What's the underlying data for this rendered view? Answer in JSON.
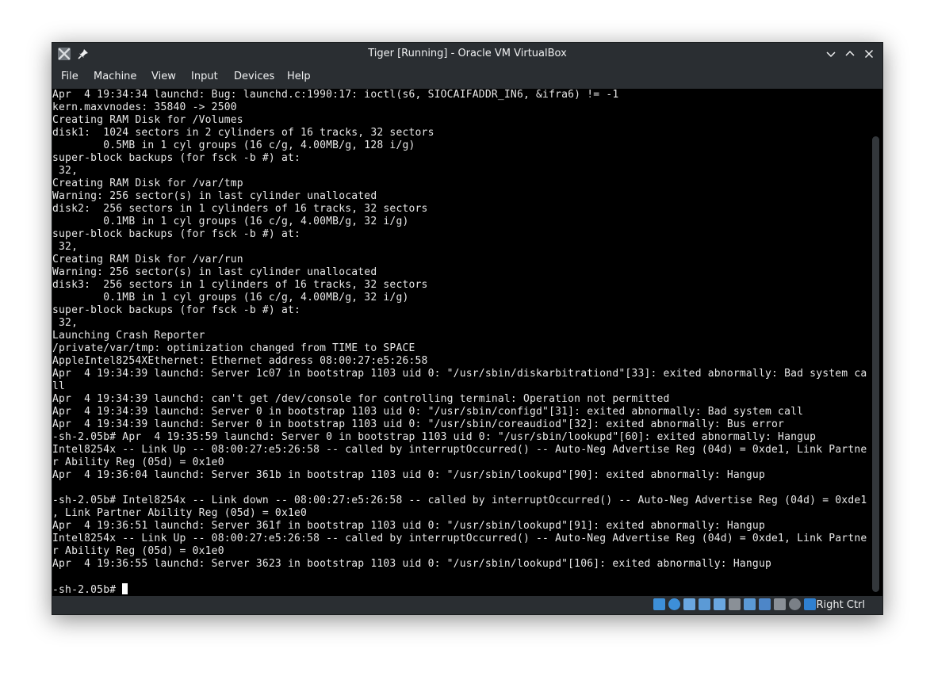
{
  "window": {
    "title": "Tiger [Running] - Oracle VM VirtualBox"
  },
  "menubar": {
    "items": [
      "File",
      "Machine",
      "View",
      "Input",
      "Devices",
      "Help"
    ]
  },
  "console": {
    "lines": [
      "Apr  4 19:34:34 launchd: Bug: launchd.c:1990:17: ioctl(s6, SIOCAIFADDR_IN6, &ifra6) != -1",
      "kern.maxvnodes: 35840 -> 2500",
      "Creating RAM Disk for /Volumes",
      "disk1:  1024 sectors in 2 cylinders of 16 tracks, 32 sectors",
      "        0.5MB in 1 cyl groups (16 c/g, 4.00MB/g, 128 i/g)",
      "super-block backups (for fsck -b #) at:",
      " 32,",
      "Creating RAM Disk for /var/tmp",
      "Warning: 256 sector(s) in last cylinder unallocated",
      "disk2:  256 sectors in 1 cylinders of 16 tracks, 32 sectors",
      "        0.1MB in 1 cyl groups (16 c/g, 4.00MB/g, 32 i/g)",
      "super-block backups (for fsck -b #) at:",
      " 32,",
      "Creating RAM Disk for /var/run",
      "Warning: 256 sector(s) in last cylinder unallocated",
      "disk3:  256 sectors in 1 cylinders of 16 tracks, 32 sectors",
      "        0.1MB in 1 cyl groups (16 c/g, 4.00MB/g, 32 i/g)",
      "super-block backups (for fsck -b #) at:",
      " 32,",
      "Launching Crash Reporter",
      "/private/var/tmp: optimization changed from TIME to SPACE",
      "AppleIntel8254XEthernet: Ethernet address 08:00:27:e5:26:58",
      "Apr  4 19:34:39 launchd: Server 1c07 in bootstrap 1103 uid 0: \"/usr/sbin/diskarbitrationd\"[33]: exited abnormally: Bad system ca",
      "ll",
      "Apr  4 19:34:39 launchd: can't get /dev/console for controlling terminal: Operation not permitted",
      "Apr  4 19:34:39 launchd: Server 0 in bootstrap 1103 uid 0: \"/usr/sbin/configd\"[31]: exited abnormally: Bad system call",
      "Apr  4 19:34:39 launchd: Server 0 in bootstrap 1103 uid 0: \"/usr/sbin/coreaudiod\"[32]: exited abnormally: Bus error",
      "-sh-2.05b# Apr  4 19:35:59 launchd: Server 0 in bootstrap 1103 uid 0: \"/usr/sbin/lookupd\"[60]: exited abnormally: Hangup",
      "Intel8254x -- Link Up -- 08:00:27:e5:26:58 -- called by interruptOccurred() -- Auto-Neg Advertise Reg (04d) = 0xde1, Link Partne",
      "r Ability Reg (05d) = 0x1e0",
      "Apr  4 19:36:04 launchd: Server 361b in bootstrap 1103 uid 0: \"/usr/sbin/lookupd\"[90]: exited abnormally: Hangup",
      "",
      "-sh-2.05b# Intel8254x -- Link down -- 08:00:27:e5:26:58 -- called by interruptOccurred() -- Auto-Neg Advertise Reg (04d) = 0xde1",
      ", Link Partner Ability Reg (05d) = 0x1e0",
      "Apr  4 19:36:51 launchd: Server 361f in bootstrap 1103 uid 0: \"/usr/sbin/lookupd\"[91]: exited abnormally: Hangup",
      "Intel8254x -- Link Up -- 08:00:27:e5:26:58 -- called by interruptOccurred() -- Auto-Neg Advertise Reg (04d) = 0xde1, Link Partne",
      "r Ability Reg (05d) = 0x1e0",
      "Apr  4 19:36:55 launchd: Server 3623 in bootstrap 1103 uid 0: \"/usr/sbin/lookupd\"[106]: exited abnormally: Hangup",
      ""
    ],
    "prompt": "-sh-2.05b# "
  },
  "statusbar": {
    "host_key": "Right Ctrl",
    "icons": [
      "hard-disk-icon",
      "optical-drive-icon",
      "audio-icon",
      "network-icon",
      "usb-icon",
      "shared-folders-icon",
      "display-icon",
      "recording-icon",
      "cpu-icon",
      "mouse-integration-icon",
      "keyboard-capture-icon"
    ]
  },
  "colors": {
    "chrome": "#2a2e32",
    "console_bg": "#000000",
    "console_fg": "#e8e8e8",
    "accent": "#1d99f3"
  }
}
